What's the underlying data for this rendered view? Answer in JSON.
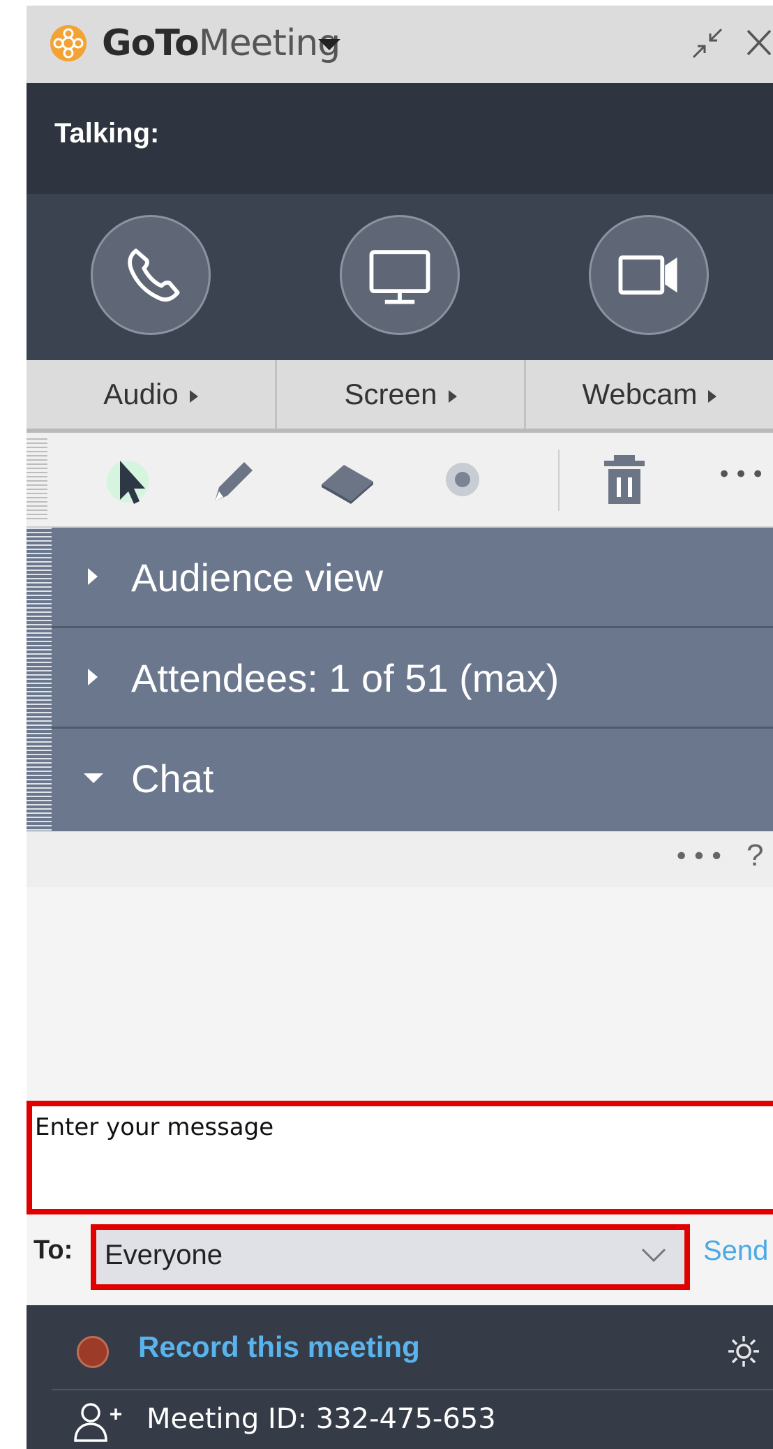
{
  "titlebar": {
    "brand_bold": "GoTo",
    "brand_light": "Meeting",
    "icons": [
      "goto-logo-icon",
      "caret-down-icon",
      "minimize-icon",
      "close-icon"
    ]
  },
  "talking": {
    "label": "Talking:"
  },
  "controls": [
    {
      "label": "Audio",
      "icon": "phone-icon"
    },
    {
      "label": "Screen",
      "icon": "monitor-icon"
    },
    {
      "label": "Webcam",
      "icon": "webcam-icon"
    }
  ],
  "toolbar": {
    "tools": [
      "pointer-icon",
      "pen-icon",
      "eraser-icon",
      "spotlight-icon",
      "trash-icon",
      "more-icon"
    ],
    "more_label": "•••"
  },
  "sections": {
    "audience": "Audience view",
    "attendees": "Attendees:  1 of 51 (max)",
    "chat": "Chat"
  },
  "chat": {
    "more_label": "•••",
    "help_label": "?",
    "input_placeholder": "Enter your message",
    "to_label": "To:",
    "to_value": "Everyone",
    "send_label": "Send"
  },
  "footer": {
    "record_label": "Record this meeting",
    "meeting_id": "Meeting ID: 332-475-653"
  },
  "colors": {
    "accent_blue": "#59b4ee",
    "highlight_red": "#e00000",
    "section_bg": "#6b778d",
    "dark_bg": "#2f3540"
  }
}
